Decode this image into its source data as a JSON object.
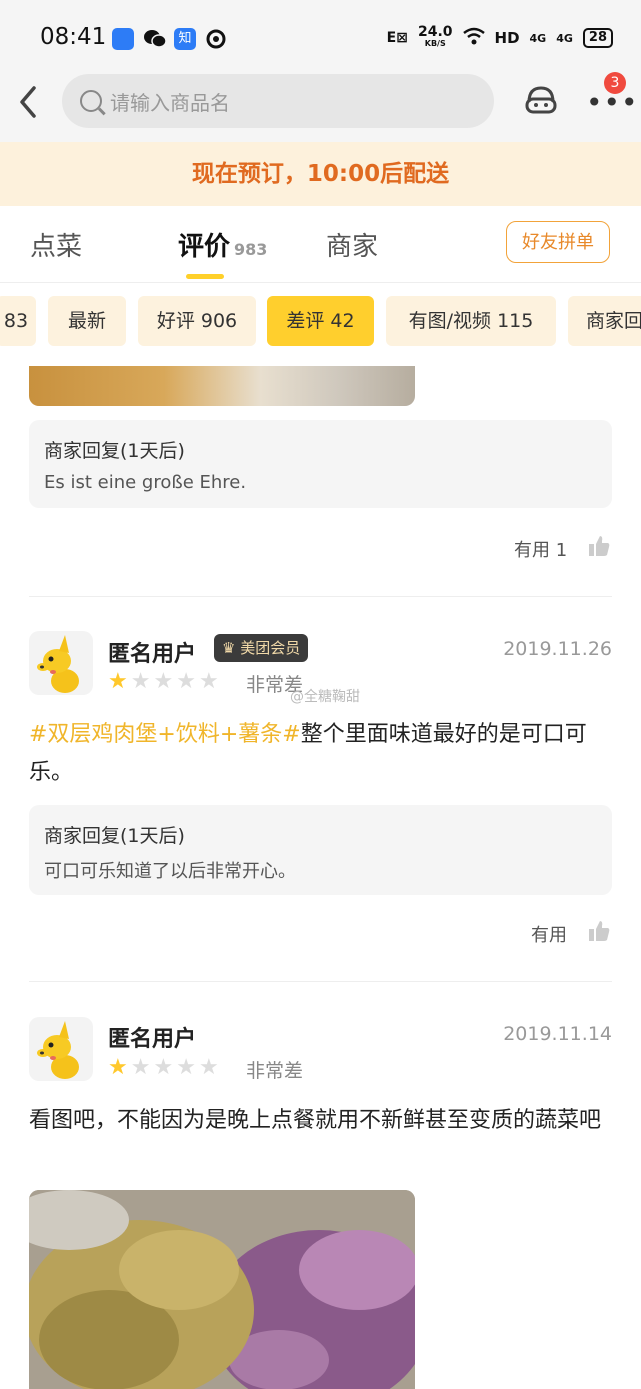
{
  "status_bar": {
    "time": "08:41",
    "network_speed": "24.0",
    "network_unit": "KB/S",
    "hd": "HD",
    "signal1": "4G",
    "signal2": "4G",
    "battery": "28"
  },
  "nav": {
    "search_placeholder": "请输入商品名",
    "notification_count": "3"
  },
  "banner": {
    "text": "现在预订，10:00后配送"
  },
  "tabs": {
    "items": [
      {
        "label": "点菜"
      },
      {
        "label": "评价",
        "count": "983"
      },
      {
        "label": "商家"
      }
    ],
    "group_button": "好友拼单"
  },
  "filters": {
    "chips": [
      {
        "label": "83"
      },
      {
        "label": "最新"
      },
      {
        "label": "好评 906"
      },
      {
        "label": "差评 42"
      },
      {
        "label": "有图/视频 115"
      },
      {
        "label": "商家回"
      }
    ],
    "active_index": 3
  },
  "reviews": [
    {
      "reply_title": "商家回复(1天后)",
      "reply_text": "Es ist eine große Ehre.",
      "useful_label": "有用 1"
    },
    {
      "username": "匿名用户",
      "member_badge": "美团会员",
      "date": "2019.11.26",
      "stars": 1,
      "rating_text": "非常差",
      "watermark": "@全糖鞠甜",
      "tag": "#双层鸡肉堡+饮料+薯条#",
      "content": "整个里面味道最好的是可口可乐。",
      "reply_title": "商家回复(1天后)",
      "reply_text": "可口可乐知道了以后非常开心。",
      "useful_label": "有用"
    },
    {
      "username": "匿名用户",
      "date": "2019.11.14",
      "stars": 1,
      "rating_text": "非常差",
      "content": "看图吧，不能因为是晚上点餐就用不新鲜甚至变质的蔬菜吧"
    }
  ],
  "colors": {
    "accent_yellow": "#ffcf2d",
    "banner_bg": "#fdf1dc",
    "banner_text": "#e06a20",
    "tag_color": "#f0b52a",
    "badge_red": "#f04a3e"
  }
}
